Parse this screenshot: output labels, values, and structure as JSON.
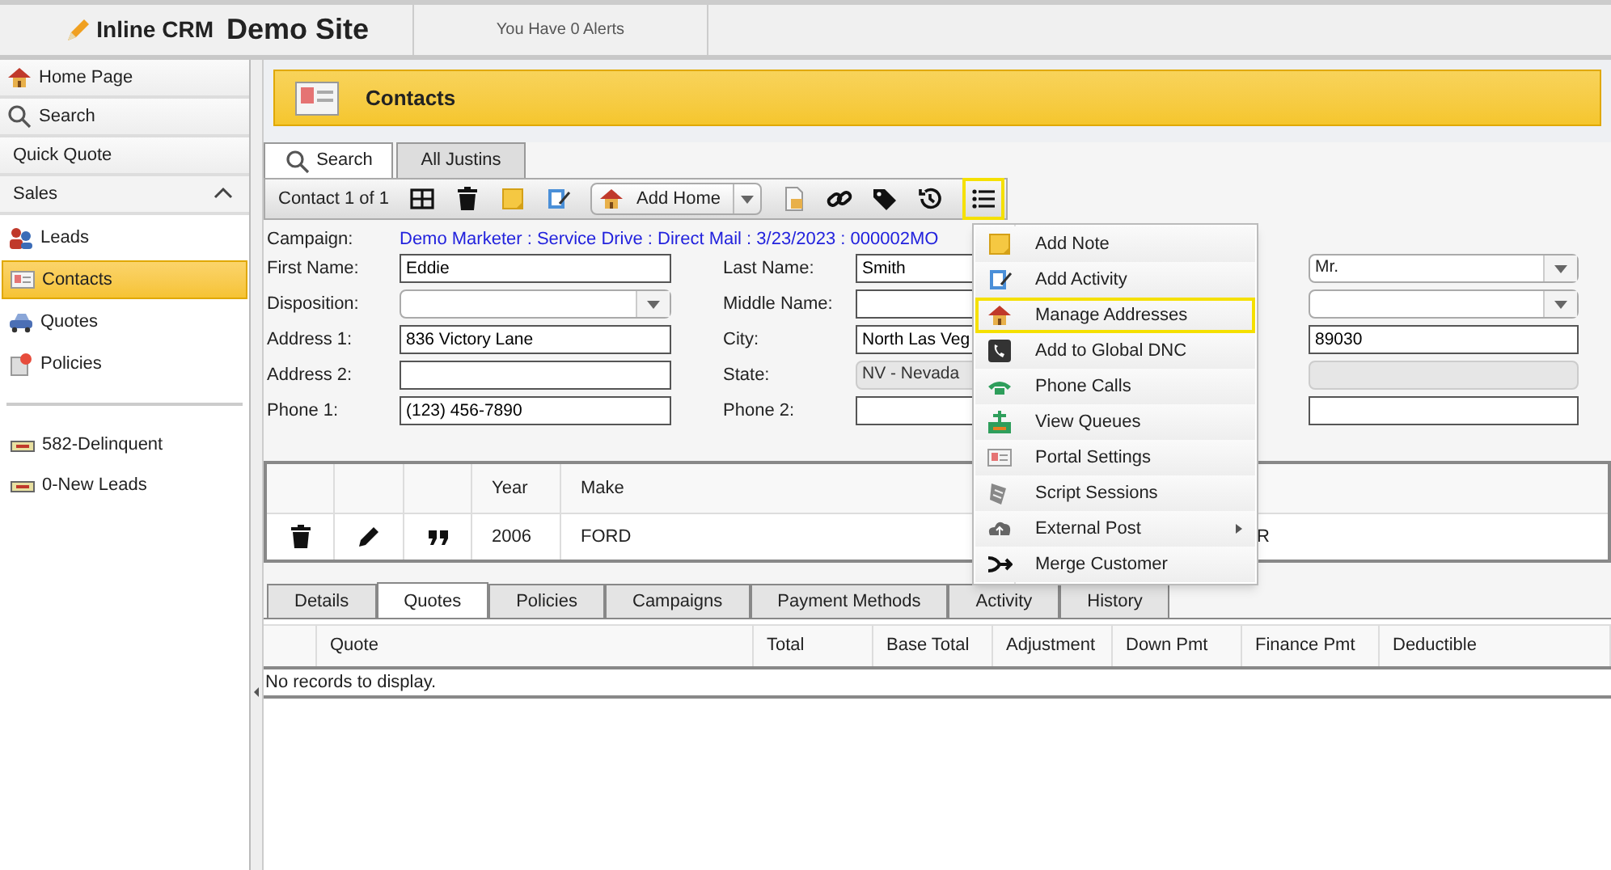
{
  "app": {
    "logo": "Inline CRM",
    "site": "Demo Site",
    "alerts": "You Have 0 Alerts"
  },
  "sidebar": {
    "top_links": [
      "Home Page",
      "Search",
      "Quick Quote"
    ],
    "section": {
      "label": "Sales",
      "expanded": true,
      "items": [
        {
          "label": "Leads",
          "selected": false
        },
        {
          "label": "Contacts",
          "selected": true
        },
        {
          "label": "Quotes",
          "selected": false
        },
        {
          "label": "Policies",
          "selected": false
        }
      ]
    },
    "queues": [
      "582-Delinquent",
      "0-New Leads"
    ]
  },
  "page_title": "Contacts",
  "tabs": [
    {
      "label": "Search",
      "selected": true
    },
    {
      "label": "All Justins",
      "selected": false
    }
  ],
  "toolbar": {
    "counter": "Contact 1 of 1",
    "add_button": "Add Home",
    "menu_button_highlighted": true
  },
  "campaign": {
    "label": "Campaign:",
    "value": "Demo Marketer : Service Drive : Direct Mail : 3/23/2023 : 000002MO"
  },
  "fields_left": [
    {
      "label": "First Name:",
      "kind": "text",
      "value": "Eddie"
    },
    {
      "label": "Disposition:",
      "kind": "select"
    },
    {
      "label": "Address 1:",
      "kind": "text",
      "value": "836 Victory Lane"
    },
    {
      "label": "Address 2:",
      "kind": "text"
    },
    {
      "label": "Phone 1:",
      "kind": "text",
      "value": "(123) 456-7890"
    }
  ],
  "fields_middle": [
    {
      "label": "Last Name:",
      "kind": "text",
      "value": "Smith"
    },
    {
      "label": "Middle Name:",
      "kind": "text"
    },
    {
      "label": "City:",
      "kind": "text",
      "value": "North Las Veg"
    },
    {
      "label": "State:",
      "kind": "disabled",
      "value": "NV - Nevada"
    },
    {
      "label": "Phone 2:",
      "kind": "text"
    }
  ],
  "fields_right": [
    {
      "kind": "select",
      "value": "Mr."
    },
    {
      "kind": "select"
    },
    {
      "kind": "text",
      "value": "89030"
    },
    {
      "kind": "disabled"
    },
    {
      "kind": "text"
    }
  ],
  "vehicles": {
    "columns": [
      "Year",
      "Make"
    ],
    "rows": [
      {
        "year": "2006",
        "make": "FORD",
        "column_3": "R"
      }
    ]
  },
  "detail_tabs": [
    {
      "label": "Details",
      "selected": false
    },
    {
      "label": "Quotes",
      "selected": true
    },
    {
      "label": "Policies",
      "selected": false
    },
    {
      "label": "Campaigns",
      "selected": false
    },
    {
      "label": "Payment Methods",
      "selected": false
    },
    {
      "label": "Activity",
      "selected": false
    },
    {
      "label": "History",
      "selected": false
    }
  ],
  "quotes_table": {
    "columns": [
      "Quote",
      "Total",
      "Base Total",
      "Adjustment",
      "Down Pmt",
      "Finance Pmt",
      "Deductible"
    ],
    "empty_message": "No records to display."
  },
  "menu": [
    {
      "label": "Add Note",
      "highlighted": false
    },
    {
      "label": "Add Activity",
      "highlighted": false
    },
    {
      "label": "Manage Addresses",
      "highlighted": true
    },
    {
      "label": "Add to Global DNC",
      "highlighted": false
    },
    {
      "label": "Phone Calls",
      "highlighted": false
    },
    {
      "label": "View Queues",
      "highlighted": false
    },
    {
      "label": "Portal Settings",
      "highlighted": false
    },
    {
      "label": "Script Sessions",
      "highlighted": false
    },
    {
      "label": "External Post",
      "highlighted": false,
      "submenu": true
    },
    {
      "label": "Merge Customer",
      "highlighted": false
    }
  ]
}
